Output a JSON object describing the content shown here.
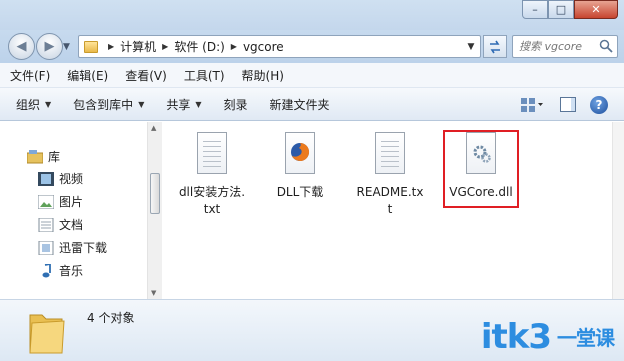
{
  "window": {
    "minimize": "–",
    "maximize": "□",
    "close": "✕"
  },
  "address": {
    "crumbs": [
      "计算机",
      "软件 (D:)",
      "vgcore"
    ],
    "search_placeholder": "搜索 vgcore"
  },
  "menu": {
    "items": [
      "文件(F)",
      "编辑(E)",
      "查看(V)",
      "工具(T)",
      "帮助(H)"
    ]
  },
  "toolbar": {
    "organize": "组织",
    "include_library": "包含到库中",
    "share": "共享",
    "burn": "刻录",
    "new_folder": "新建文件夹"
  },
  "nav": {
    "items": [
      {
        "label": "库",
        "icon": "library-icon"
      },
      {
        "label": "视频",
        "icon": "video-icon"
      },
      {
        "label": "图片",
        "icon": "picture-icon"
      },
      {
        "label": "文档",
        "icon": "document-icon"
      },
      {
        "label": "迅雷下载",
        "icon": "download-icon"
      },
      {
        "label": "音乐",
        "icon": "music-icon"
      }
    ]
  },
  "files": [
    {
      "name": "dll安装方法.txt",
      "icon": "text-file-icon"
    },
    {
      "name": "DLL下载",
      "icon": "firefox-shortcut-icon"
    },
    {
      "name": "README.txt",
      "icon": "text-file-icon"
    },
    {
      "name": "VGCore.dll",
      "icon": "dll-file-icon",
      "highlighted": true
    }
  ],
  "status": {
    "count": "4 个对象"
  },
  "watermark": {
    "text": "itk3",
    "sub": "一堂课"
  },
  "colors": {
    "highlight_border": "#e01e24",
    "watermark": "#2d8de0"
  }
}
